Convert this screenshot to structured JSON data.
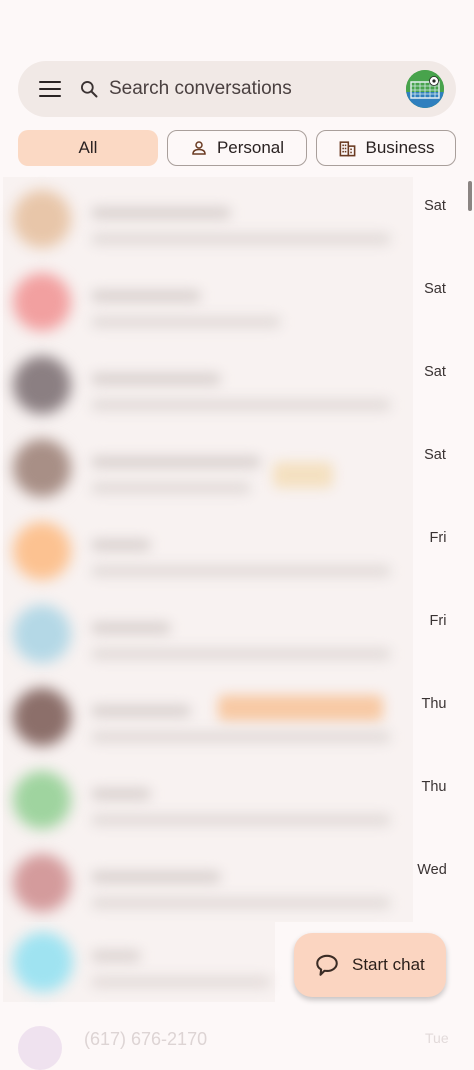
{
  "search": {
    "placeholder": "Search conversations"
  },
  "filters": [
    {
      "label": "All",
      "selected": true
    },
    {
      "label": "Personal",
      "icon": "person-icon"
    },
    {
      "label": "Business",
      "icon": "building-icon"
    }
  ],
  "conversations": [
    {
      "time": "Sat",
      "avatar_color": "#e8c6a9"
    },
    {
      "time": "Sat",
      "avatar_color": "#f2a0a0"
    },
    {
      "time": "Sat",
      "avatar_color": "#8b7f82"
    },
    {
      "time": "Sat",
      "avatar_color": "#a88f86"
    },
    {
      "time": "Fri",
      "avatar_color": "#fcc291"
    },
    {
      "time": "Fri",
      "avatar_color": "#b4d8e6"
    },
    {
      "time": "Thu",
      "avatar_color": "#8c6f6a"
    },
    {
      "time": "Thu",
      "avatar_color": "#9fd49f"
    },
    {
      "time": "Wed",
      "avatar_color": "#d49b9c"
    }
  ],
  "partial_row": {
    "phone": "(617) 676-2170",
    "time": "Tue"
  },
  "fab": {
    "label": "Start chat"
  },
  "colors": {
    "accent": "#fbd9c4",
    "surface": "#f1e9e6",
    "background": "#fdf8f8"
  }
}
